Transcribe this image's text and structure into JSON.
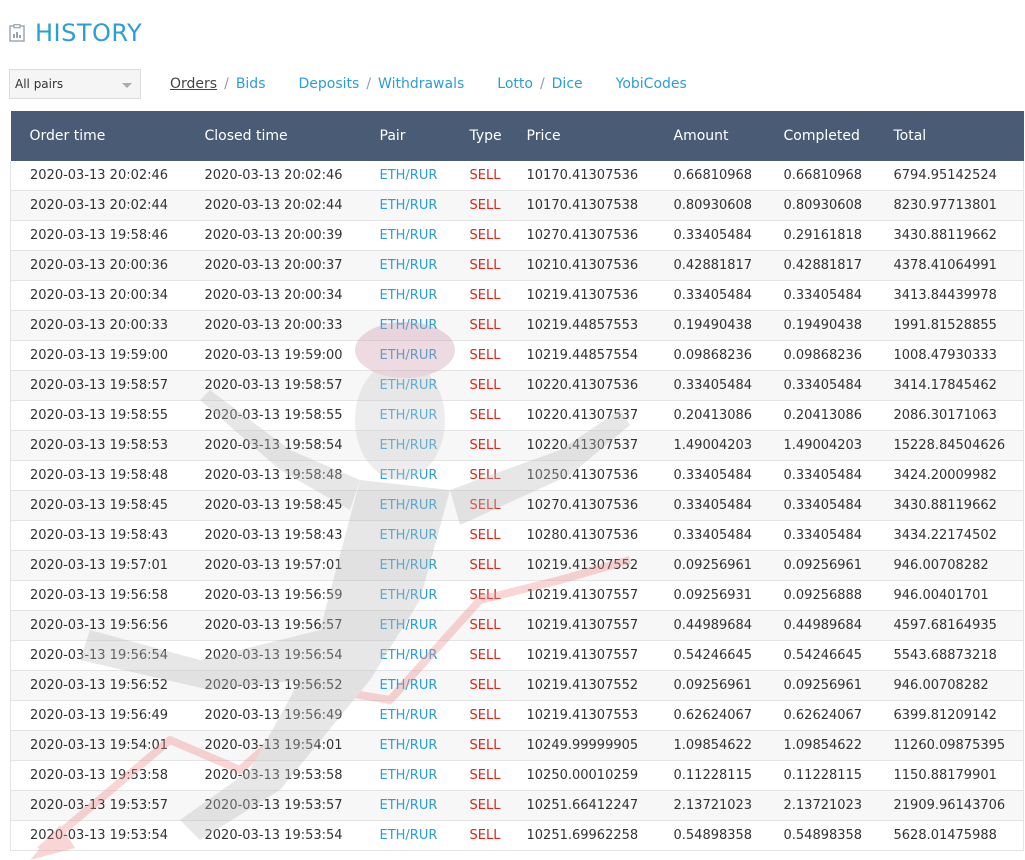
{
  "header": {
    "title": "HISTORY",
    "icon": "report-icon"
  },
  "filter": {
    "selected": "All pairs"
  },
  "nav": {
    "orders": "Orders",
    "bids": "Bids",
    "deposits": "Deposits",
    "withdrawals": "Withdrawals",
    "lotto": "Lotto",
    "dice": "Dice",
    "yobicodes": "YobiCodes",
    "sep": "/"
  },
  "colors": {
    "accent": "#2a9fd6",
    "header_bg": "#4a5c75",
    "sell": "#d9261c"
  },
  "table": {
    "columns": [
      "Order time",
      "Closed time",
      "Pair",
      "Type",
      "Price",
      "Amount",
      "Completed",
      "Total"
    ],
    "rows": [
      [
        "2020-03-13 20:02:46",
        "2020-03-13 20:02:46",
        "ETH/RUR",
        "SELL",
        "10170.41307536",
        "0.66810968",
        "0.66810968",
        "6794.95142524"
      ],
      [
        "2020-03-13 20:02:44",
        "2020-03-13 20:02:44",
        "ETH/RUR",
        "SELL",
        "10170.41307538",
        "0.80930608",
        "0.80930608",
        "8230.97713801"
      ],
      [
        "2020-03-13 19:58:46",
        "2020-03-13 20:00:39",
        "ETH/RUR",
        "SELL",
        "10270.41307536",
        "0.33405484",
        "0.29161818",
        "3430.88119662"
      ],
      [
        "2020-03-13 20:00:36",
        "2020-03-13 20:00:37",
        "ETH/RUR",
        "SELL",
        "10210.41307536",
        "0.42881817",
        "0.42881817",
        "4378.41064991"
      ],
      [
        "2020-03-13 20:00:34",
        "2020-03-13 20:00:34",
        "ETH/RUR",
        "SELL",
        "10219.41307536",
        "0.33405484",
        "0.33405484",
        "3413.84439978"
      ],
      [
        "2020-03-13 20:00:33",
        "2020-03-13 20:00:33",
        "ETH/RUR",
        "SELL",
        "10219.44857553",
        "0.19490438",
        "0.19490438",
        "1991.81528855"
      ],
      [
        "2020-03-13 19:59:00",
        "2020-03-13 19:59:00",
        "ETH/RUR",
        "SELL",
        "10219.44857554",
        "0.09868236",
        "0.09868236",
        "1008.47930333"
      ],
      [
        "2020-03-13 19:58:57",
        "2020-03-13 19:58:57",
        "ETH/RUR",
        "SELL",
        "10220.41307536",
        "0.33405484",
        "0.33405484",
        "3414.17845462"
      ],
      [
        "2020-03-13 19:58:55",
        "2020-03-13 19:58:55",
        "ETH/RUR",
        "SELL",
        "10220.41307537",
        "0.20413086",
        "0.20413086",
        "2086.30171063"
      ],
      [
        "2020-03-13 19:58:53",
        "2020-03-13 19:58:54",
        "ETH/RUR",
        "SELL",
        "10220.41307537",
        "1.49004203",
        "1.49004203",
        "15228.84504626"
      ],
      [
        "2020-03-13 19:58:48",
        "2020-03-13 19:58:48",
        "ETH/RUR",
        "SELL",
        "10250.41307536",
        "0.33405484",
        "0.33405484",
        "3424.20009982"
      ],
      [
        "2020-03-13 19:58:45",
        "2020-03-13 19:58:45",
        "ETH/RUR",
        "SELL",
        "10270.41307536",
        "0.33405484",
        "0.33405484",
        "3430.88119662"
      ],
      [
        "2020-03-13 19:58:43",
        "2020-03-13 19:58:43",
        "ETH/RUR",
        "SELL",
        "10280.41307536",
        "0.33405484",
        "0.33405484",
        "3434.22174502"
      ],
      [
        "2020-03-13 19:57:01",
        "2020-03-13 19:57:01",
        "ETH/RUR",
        "SELL",
        "10219.41307552",
        "0.09256961",
        "0.09256961",
        "946.00708282"
      ],
      [
        "2020-03-13 19:56:58",
        "2020-03-13 19:56:59",
        "ETH/RUR",
        "SELL",
        "10219.41307557",
        "0.09256931",
        "0.09256888",
        "946.00401701"
      ],
      [
        "2020-03-13 19:56:56",
        "2020-03-13 19:56:57",
        "ETH/RUR",
        "SELL",
        "10219.41307557",
        "0.44989684",
        "0.44989684",
        "4597.68164935"
      ],
      [
        "2020-03-13 19:56:54",
        "2020-03-13 19:56:54",
        "ETH/RUR",
        "SELL",
        "10219.41307557",
        "0.54246645",
        "0.54246645",
        "5543.68873218"
      ],
      [
        "2020-03-13 19:56:52",
        "2020-03-13 19:56:52",
        "ETH/RUR",
        "SELL",
        "10219.41307552",
        "0.09256961",
        "0.09256961",
        "946.00708282"
      ],
      [
        "2020-03-13 19:56:49",
        "2020-03-13 19:56:49",
        "ETH/RUR",
        "SELL",
        "10219.41307553",
        "0.62624067",
        "0.62624067",
        "6399.81209142"
      ],
      [
        "2020-03-13 19:54:01",
        "2020-03-13 19:54:01",
        "ETH/RUR",
        "SELL",
        "10249.99999905",
        "1.09854622",
        "1.09854622",
        "11260.09875395"
      ],
      [
        "2020-03-13 19:53:58",
        "2020-03-13 19:53:58",
        "ETH/RUR",
        "SELL",
        "10250.00010259",
        "0.11228115",
        "0.11228115",
        "1150.88179901"
      ],
      [
        "2020-03-13 19:53:57",
        "2020-03-13 19:53:57",
        "ETH/RUR",
        "SELL",
        "10251.66412247",
        "2.13721023",
        "2.13721023",
        "21909.96143706"
      ],
      [
        "2020-03-13 19:53:54",
        "2020-03-13 19:53:54",
        "ETH/RUR",
        "SELL",
        "10251.69962258",
        "0.54898358",
        "0.54898358",
        "5628.01475988"
      ]
    ]
  }
}
